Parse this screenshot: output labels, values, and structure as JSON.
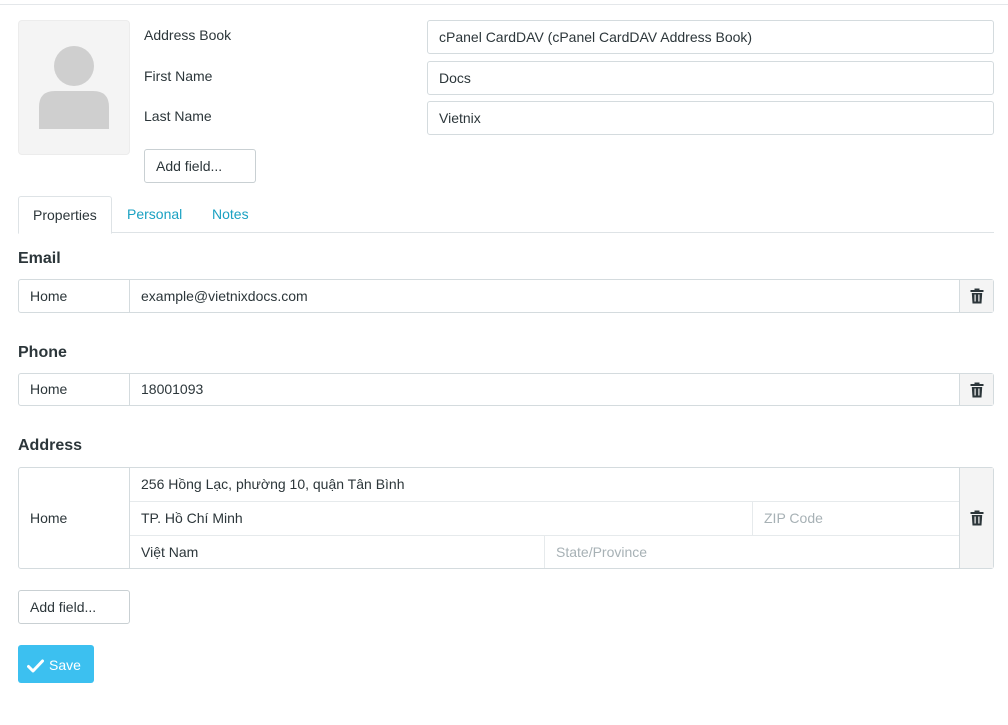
{
  "header": {
    "address_book_label": "Address Book",
    "address_book_value": "cPanel CardDAV (cPanel CardDAV Address Book)",
    "first_name_label": "First Name",
    "first_name_value": "Docs",
    "last_name_label": "Last Name",
    "last_name_value": "Vietnix",
    "add_field_label": "Add field..."
  },
  "tabs": [
    {
      "label": "Properties",
      "active": true
    },
    {
      "label": "Personal",
      "active": false
    },
    {
      "label": "Notes",
      "active": false
    }
  ],
  "email": {
    "title": "Email",
    "type": "Home",
    "value": "example@vietnixdocs.com"
  },
  "phone": {
    "title": "Phone",
    "type": "Home",
    "value": "18001093"
  },
  "address": {
    "title": "Address",
    "type": "Home",
    "street": "256 Hồng Lạc, phường 10, quận Tân Bình",
    "city": "TP. Hồ Chí Minh",
    "zip_placeholder": "ZIP Code",
    "country": "Việt Nam",
    "state_placeholder": "State/Province"
  },
  "footer": {
    "add_field_label": "Add field...",
    "save_label": "Save"
  },
  "colors": {
    "accent": "#3cc0f0",
    "link": "#1aa1c2"
  },
  "icons": {
    "avatar": "person-silhouette-icon",
    "delete": "trash-icon",
    "save": "checkmark-icon"
  }
}
